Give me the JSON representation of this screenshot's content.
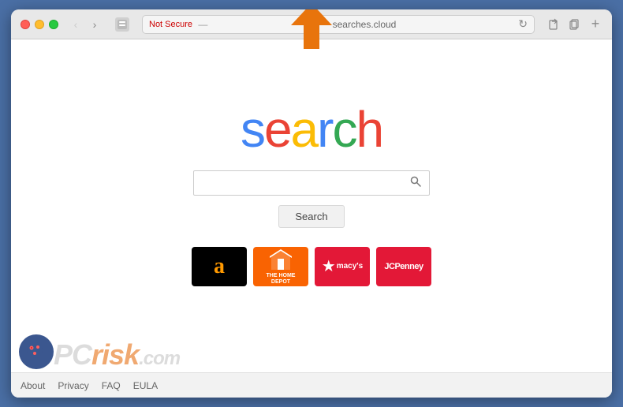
{
  "browser": {
    "address_bar": {
      "security_label": "Not Secure",
      "separator": "—",
      "url": "searches.cloud"
    },
    "nav": {
      "back_label": "‹",
      "forward_label": "›"
    }
  },
  "page": {
    "logo_letters": [
      "s",
      "e",
      "a",
      "r",
      "c",
      "h"
    ],
    "search_placeholder": "",
    "search_button_label": "Search",
    "quick_links": [
      {
        "name": "Amazon",
        "type": "amazon"
      },
      {
        "name": "The Home Depot",
        "type": "homedepot"
      },
      {
        "name": "Macy's",
        "type": "macys"
      },
      {
        "name": "JCPenney",
        "type": "jcpenney"
      }
    ],
    "footer_links": [
      "About",
      "Privacy",
      "FAQ",
      "EULA"
    ]
  },
  "watermark": {
    "pc_text": "PC",
    "risk_text": "risk",
    "dot_com": ".com"
  }
}
